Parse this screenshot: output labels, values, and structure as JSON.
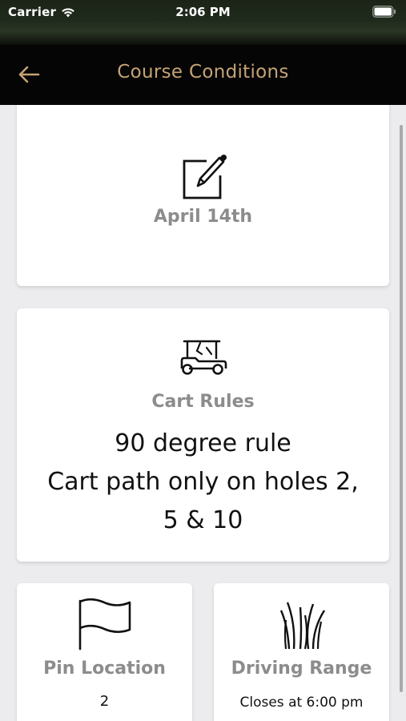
{
  "status_bar": {
    "carrier": "Carrier",
    "time": "2:06 PM"
  },
  "nav": {
    "title": "Course Conditions",
    "back_icon": "arrow-left-icon",
    "title_color": "#c5a375"
  },
  "cards": {
    "date": {
      "icon": "edit-icon",
      "label": "April 14th"
    },
    "cart_rules": {
      "icon": "golf-cart-icon",
      "label": "Cart Rules",
      "lines": [
        "90 degree rule",
        "Cart path only on holes 2,",
        "5 & 10"
      ]
    },
    "pin_location": {
      "icon": "flag-icon",
      "label": "Pin Location",
      "value": "2"
    },
    "driving_range": {
      "icon": "grass-icon",
      "label": "Driving Range",
      "value": "Closes at 6:00 pm"
    }
  }
}
